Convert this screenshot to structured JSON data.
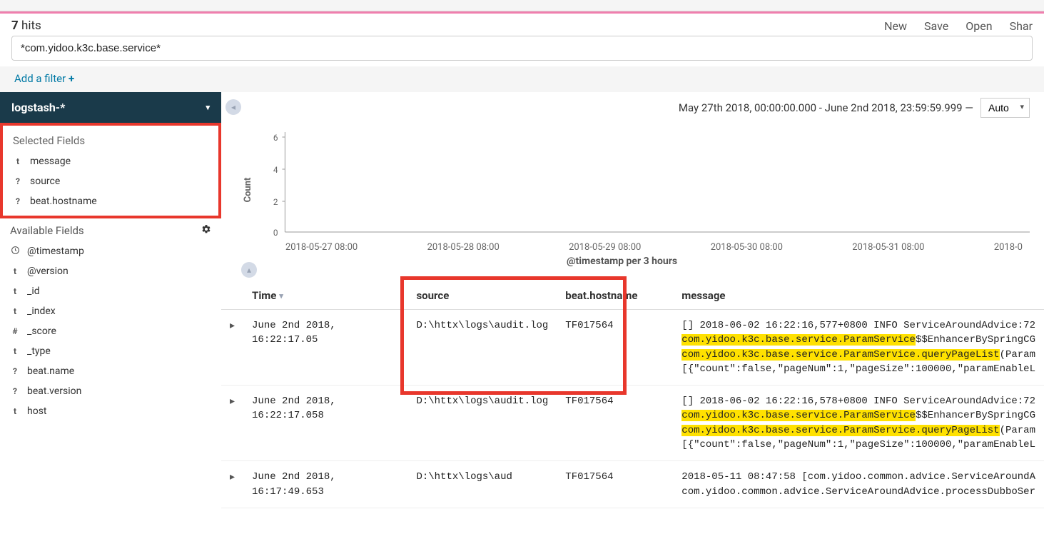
{
  "browser_url": "192.168.250.128:5601/app/kibana#/discover?_g=(refreshInterval:($$hashKey:'object:191',display:'5%20seconds',pause:!t,section:1,value:5000),time:(from:no",
  "hits_count": "7",
  "hits_label": "hits",
  "top_actions": [
    "New",
    "Save",
    "Open",
    "Shar"
  ],
  "search_value": "*com.yidoo.k3c.base.service*",
  "add_filter_label": "Add a filter",
  "index_pattern": "logstash-*",
  "selected_fields_title": "Selected Fields",
  "selected_fields": [
    {
      "type": "t",
      "name": "message"
    },
    {
      "type": "?",
      "name": "source"
    },
    {
      "type": "?",
      "name": "beat.hostname"
    }
  ],
  "available_fields_title": "Available Fields",
  "available_fields": [
    {
      "type": "clock",
      "name": "@timestamp"
    },
    {
      "type": "t",
      "name": "@version"
    },
    {
      "type": "t",
      "name": "_id"
    },
    {
      "type": "t",
      "name": "_index"
    },
    {
      "type": "#",
      "name": "_score"
    },
    {
      "type": "t",
      "name": "_type"
    },
    {
      "type": "?",
      "name": "beat.name"
    },
    {
      "type": "?",
      "name": "beat.version"
    },
    {
      "type": "t",
      "name": "host"
    }
  ],
  "date_range_text": "May 27th 2018, 00:00:00.000 - June 2nd 2018, 23:59:59.999 —",
  "interval_value": "Auto",
  "chart_data": {
    "type": "bar",
    "ylabel": "Count",
    "ylim": [
      0,
      6
    ],
    "yticks": [
      0,
      2,
      4,
      6
    ],
    "xticks": [
      "2018-05-27 08:00",
      "2018-05-28 08:00",
      "2018-05-29 08:00",
      "2018-05-30 08:00",
      "2018-05-31 08:00",
      "2018-0"
    ],
    "xlabel": "@timestamp per 3 hours",
    "values": []
  },
  "table": {
    "headers": {
      "time": "Time",
      "source": "source",
      "host": "beat.hostname",
      "message": "message"
    },
    "rows": [
      {
        "time": "June 2nd 2018, 16:22:17.05",
        "source": "D:\\httx\\logs\\audit.log",
        "host": "TF017564",
        "msg_pre": "[] 2018-06-02 16:22:16,577+0800 INFO ServiceAroundAdvice:72",
        "msg_hl1": "com.yidoo.k3c.base.service.ParamService",
        "msg_mid": "$$EnhancerBySpringCG",
        "msg_hl2": "com.yidoo.k3c.base.service.ParamService.queryPageList",
        "msg_post": "(Param",
        "msg_line4": "[{\"count\":false,\"pageNum\":1,\"pageSize\":100000,\"paramEnableL"
      },
      {
        "time": "June 2nd 2018, 16:22:17.058",
        "source": "D:\\httx\\logs\\audit.log",
        "host": "TF017564",
        "msg_pre": "[] 2018-06-02 16:22:16,578+0800 INFO ServiceAroundAdvice:72",
        "msg_hl1": "com.yidoo.k3c.base.service.ParamService",
        "msg_mid": "$$EnhancerBySpringCG",
        "msg_hl2": "com.yidoo.k3c.base.service.ParamService.queryPageList",
        "msg_post": "(Param",
        "msg_line4": "[{\"count\":false,\"pageNum\":1,\"pageSize\":100000,\"paramEnableL"
      },
      {
        "time": "June 2nd 2018, 16:17:49.653",
        "source": "D:\\httx\\logs\\aud",
        "host": "TF017564",
        "msg_pre": "2018-05-11 08:47:58 [com.yidoo.common.advice.ServiceAroundA",
        "msg_line4": "com.yidoo.common.advice.ServiceAroundAdvice.processDubboSer"
      }
    ]
  }
}
